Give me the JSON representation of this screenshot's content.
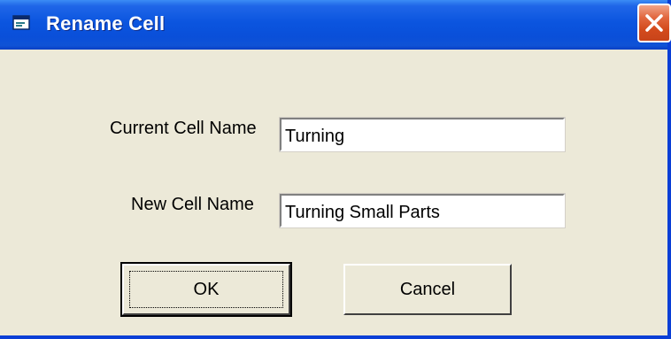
{
  "window": {
    "title": "Rename Cell",
    "title_icon": "app-window-icon",
    "close_icon": "close-icon",
    "titlebar_color": "#0a4fd9",
    "close_color": "#e2673e"
  },
  "form": {
    "current_label": "Current Cell Name",
    "current_value": "Turning",
    "new_label": "New Cell Name",
    "new_value": "Turning Small Parts"
  },
  "buttons": {
    "ok_label": "OK",
    "cancel_label": "Cancel"
  }
}
